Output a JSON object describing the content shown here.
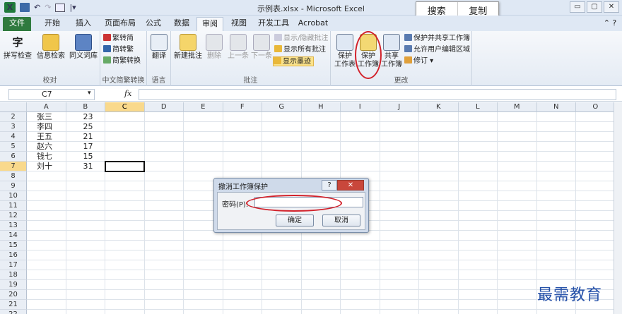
{
  "window": {
    "title": "示例表.xlsx - Microsoft Excel",
    "minimize": "▭",
    "restore": "▢",
    "close": "✕"
  },
  "qat": {
    "logo": "X",
    "undo_glyph": "↶",
    "redo_glyph": "↷",
    "more_glyph": "|▾"
  },
  "overlay": {
    "search_label": "搜索",
    "copy_label": "复制"
  },
  "tabs": [
    {
      "label": "文件"
    },
    {
      "label": "开始"
    },
    {
      "label": "插入"
    },
    {
      "label": "页面布局"
    },
    {
      "label": "公式"
    },
    {
      "label": "数据"
    },
    {
      "label": "审阅"
    },
    {
      "label": "视图"
    },
    {
      "label": "开发工具"
    },
    {
      "label": "Acrobat"
    }
  ],
  "ribbon": {
    "proofing": {
      "name": "校对",
      "spell": "拼写检查",
      "research": "信息检索",
      "thesaurus": "同义词库"
    },
    "chinese": {
      "name": "中文简繁转换",
      "to_trad": "繁转简",
      "to_simp": "简转繁",
      "convert": "简繁转换"
    },
    "language": {
      "name": "语言",
      "translate": "翻译"
    },
    "comments": {
      "name": "批注",
      "new": "新建批注",
      "delete": "删除",
      "prev": "上一条",
      "next": "下一条",
      "show_hide": "显示/隐藏批注",
      "show_all": "显示所有批注",
      "show_ink": "显示墨迹"
    },
    "changes": {
      "name": "更改",
      "protect_sheet_1": "保护",
      "protect_sheet_2": "工作表",
      "protect_book_1": "保护",
      "protect_book_2": "工作簿",
      "share_1": "共享",
      "share_2": "工作簿",
      "protect_share": "保护并共享工作簿",
      "allow_users": "允许用户编辑区域",
      "track": "修订 ▾"
    }
  },
  "formula_bar": {
    "name_box": "C7",
    "fx": "fx",
    "value": ""
  },
  "sheet": {
    "columns": [
      "A",
      "B",
      "C",
      "D",
      "E",
      "F",
      "G",
      "H",
      "I",
      "J",
      "K",
      "L",
      "M",
      "N",
      "O"
    ],
    "selected_col": "C",
    "selected_row": "7",
    "rows": [
      {
        "n": "2",
        "a": "张三",
        "b": "23"
      },
      {
        "n": "3",
        "a": "李四",
        "b": "25"
      },
      {
        "n": "4",
        "a": "王五",
        "b": "21"
      },
      {
        "n": "5",
        "a": "赵六",
        "b": "17"
      },
      {
        "n": "6",
        "a": "钱七",
        "b": "15"
      },
      {
        "n": "7",
        "a": "刘十",
        "b": "31"
      },
      {
        "n": "8",
        "a": "",
        "b": ""
      },
      {
        "n": "9",
        "a": "",
        "b": ""
      },
      {
        "n": "10",
        "a": "",
        "b": ""
      },
      {
        "n": "11",
        "a": "",
        "b": ""
      },
      {
        "n": "12",
        "a": "",
        "b": ""
      },
      {
        "n": "13",
        "a": "",
        "b": ""
      },
      {
        "n": "14",
        "a": "",
        "b": ""
      },
      {
        "n": "15",
        "a": "",
        "b": ""
      },
      {
        "n": "16",
        "a": "",
        "b": ""
      },
      {
        "n": "17",
        "a": "",
        "b": ""
      },
      {
        "n": "18",
        "a": "",
        "b": ""
      },
      {
        "n": "19",
        "a": "",
        "b": ""
      },
      {
        "n": "20",
        "a": "",
        "b": ""
      },
      {
        "n": "21",
        "a": "",
        "b": ""
      },
      {
        "n": "22",
        "a": "",
        "b": ""
      }
    ]
  },
  "dialog": {
    "title": "撤消工作簿保护",
    "help": "?",
    "close": "✕",
    "password_label": "密码(P):",
    "password_value": "",
    "ok": "确定",
    "cancel": "取消"
  },
  "watermark": "最需教育",
  "colors": {
    "file_tab": "#2f7a3e",
    "selection": "#f9d98c",
    "annotation": "#d2212a",
    "watermark": "#2450a8"
  }
}
